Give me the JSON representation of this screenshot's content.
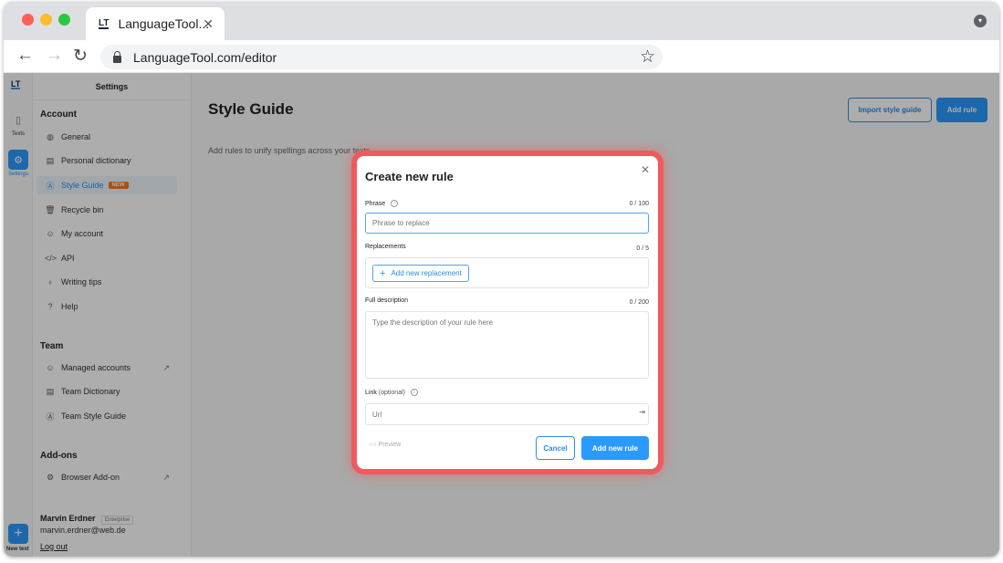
{
  "browser": {
    "tab_title": "LanguageTool...",
    "tab_favicon": "LT",
    "url": "LanguageTool.com/editor",
    "traffic_colors": [
      "#fe5f57",
      "#febc2e",
      "#28c840"
    ]
  },
  "rail": {
    "logo": "LT",
    "items": [
      {
        "label": "Texts",
        "icon": "document-icon"
      },
      {
        "label": "Settings",
        "icon": "gear-icon"
      }
    ],
    "new_label": "New text"
  },
  "settings": {
    "header": "Settings",
    "groups": {
      "account": "Account",
      "team": "Team",
      "addons": "Add-ons"
    },
    "account_items": [
      {
        "label": "General",
        "icon": "globe-icon"
      },
      {
        "label": "Personal dictionary",
        "icon": "book-icon"
      },
      {
        "label": "Style Guide",
        "icon": "style-icon",
        "badge": "NEW"
      },
      {
        "label": "Recycle bin",
        "icon": "trash-icon"
      },
      {
        "label": "My account",
        "icon": "user-icon"
      },
      {
        "label": "API",
        "icon": "code-icon"
      },
      {
        "label": "Writing tips",
        "icon": "bulb-icon"
      },
      {
        "label": "Help",
        "icon": "help-icon"
      }
    ],
    "team_items": [
      {
        "label": "Managed accounts",
        "icon": "user-icon"
      },
      {
        "label": "Team Dictionary",
        "icon": "book-icon"
      },
      {
        "label": "Team Style Guide",
        "icon": "style-icon"
      }
    ],
    "addon_items": [
      {
        "label": "Browser Add-on",
        "icon": "gear-icon"
      }
    ],
    "user": {
      "name": "Marvin Erdner",
      "tier": "Enterprise",
      "email": "marvin.erdner@web.de",
      "logout": "Log out"
    }
  },
  "main": {
    "title": "Style Guide",
    "subtitle": "Add rules to unify spellings across your texts.",
    "import_button": "Import style guide",
    "add_button": "Add rule"
  },
  "modal": {
    "title": "Create new rule",
    "phrase_label": "Phrase",
    "phrase_count": "0 / 100",
    "phrase_placeholder": "Phrase to replace",
    "replacements_label": "Replacements",
    "replacements_count": "0 / 5",
    "add_replacement": "Add new replacement",
    "description_label": "Full description",
    "description_count": "0 / 200",
    "description_placeholder": "Type the description of your rule here",
    "link_label": "Link",
    "link_optional": "(optional)",
    "link_placeholder": "Url",
    "preview": "Preview",
    "cancel": "Cancel",
    "submit": "Add new rule"
  }
}
